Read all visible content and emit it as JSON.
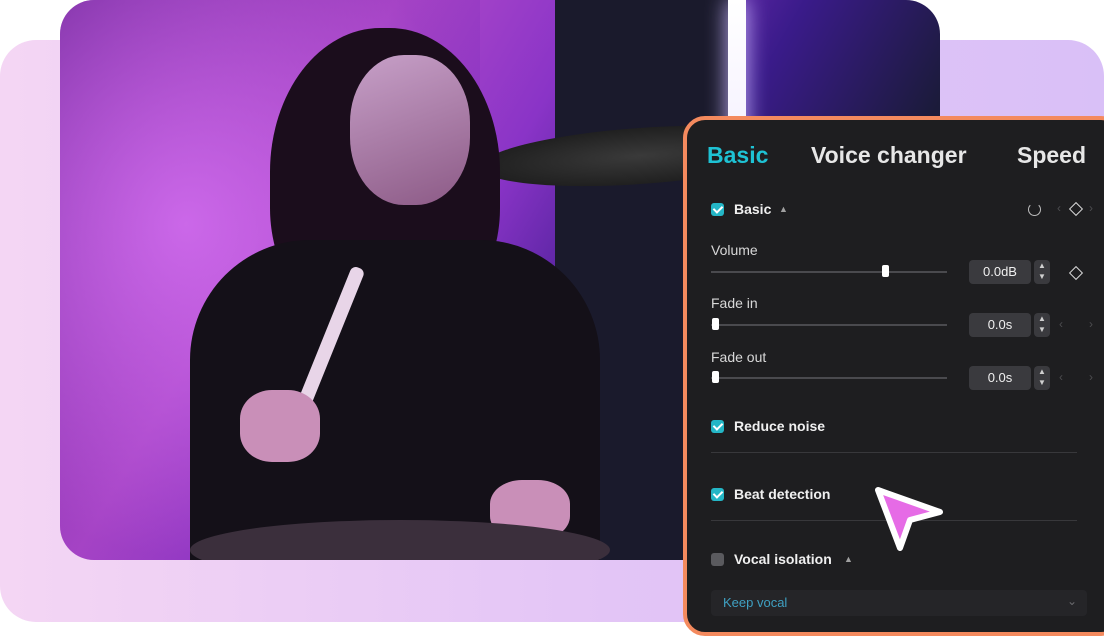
{
  "tabs": [
    {
      "label": "Basic",
      "active": true
    },
    {
      "label": "Voice changer",
      "active": false
    },
    {
      "label": "Speed",
      "active": false
    }
  ],
  "sections": {
    "basic": {
      "label": "Basic",
      "checked": true
    },
    "volume": {
      "label": "Volume",
      "value": "0.0dB"
    },
    "fade_in": {
      "label": "Fade in",
      "value": "0.0s"
    },
    "fade_out": {
      "label": "Fade out",
      "value": "0.0s"
    },
    "reduce_noise": {
      "label": "Reduce noise",
      "checked": true
    },
    "beat_detection": {
      "label": "Beat detection",
      "checked": true
    },
    "vocal_isolation": {
      "label": "Vocal isolation",
      "checked": false,
      "option": "Keep vocal"
    }
  },
  "colors": {
    "accent": "#1ec2d4",
    "panel_border": "#f48a5e",
    "cursor": "#e66be6"
  },
  "icons": {
    "reset": "reset-icon",
    "keyframe": "keyframe-diamond-icon",
    "cursor": "pointer-cursor-icon"
  }
}
